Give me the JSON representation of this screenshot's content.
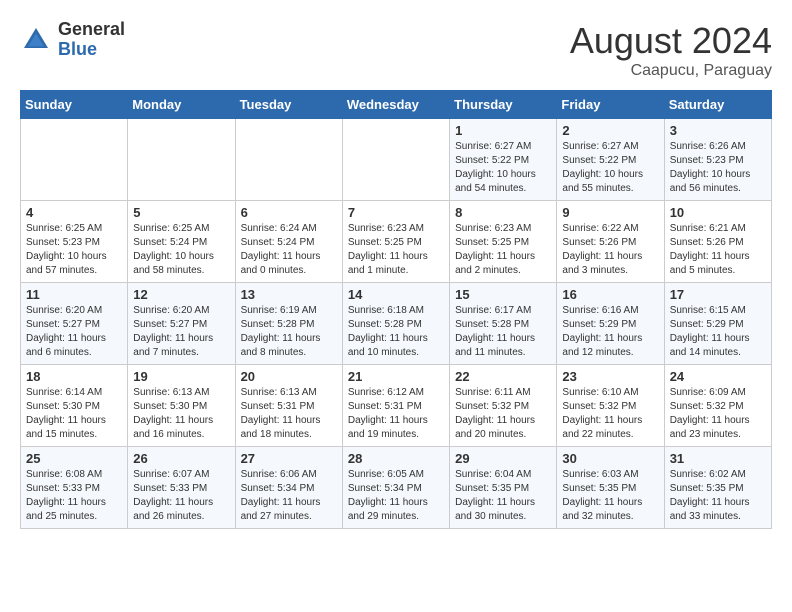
{
  "header": {
    "logo_general": "General",
    "logo_blue": "Blue",
    "month_year": "August 2024",
    "location": "Caapucu, Paraguay"
  },
  "days_of_week": [
    "Sunday",
    "Monday",
    "Tuesday",
    "Wednesday",
    "Thursday",
    "Friday",
    "Saturday"
  ],
  "weeks": [
    [
      {
        "day": "",
        "text": ""
      },
      {
        "day": "",
        "text": ""
      },
      {
        "day": "",
        "text": ""
      },
      {
        "day": "",
        "text": ""
      },
      {
        "day": "1",
        "text": "Sunrise: 6:27 AM\nSunset: 5:22 PM\nDaylight: 10 hours\nand 54 minutes."
      },
      {
        "day": "2",
        "text": "Sunrise: 6:27 AM\nSunset: 5:22 PM\nDaylight: 10 hours\nand 55 minutes."
      },
      {
        "day": "3",
        "text": "Sunrise: 6:26 AM\nSunset: 5:23 PM\nDaylight: 10 hours\nand 56 minutes."
      }
    ],
    [
      {
        "day": "4",
        "text": "Sunrise: 6:25 AM\nSunset: 5:23 PM\nDaylight: 10 hours\nand 57 minutes."
      },
      {
        "day": "5",
        "text": "Sunrise: 6:25 AM\nSunset: 5:24 PM\nDaylight: 10 hours\nand 58 minutes."
      },
      {
        "day": "6",
        "text": "Sunrise: 6:24 AM\nSunset: 5:24 PM\nDaylight: 11 hours\nand 0 minutes."
      },
      {
        "day": "7",
        "text": "Sunrise: 6:23 AM\nSunset: 5:25 PM\nDaylight: 11 hours\nand 1 minute."
      },
      {
        "day": "8",
        "text": "Sunrise: 6:23 AM\nSunset: 5:25 PM\nDaylight: 11 hours\nand 2 minutes."
      },
      {
        "day": "9",
        "text": "Sunrise: 6:22 AM\nSunset: 5:26 PM\nDaylight: 11 hours\nand 3 minutes."
      },
      {
        "day": "10",
        "text": "Sunrise: 6:21 AM\nSunset: 5:26 PM\nDaylight: 11 hours\nand 5 minutes."
      }
    ],
    [
      {
        "day": "11",
        "text": "Sunrise: 6:20 AM\nSunset: 5:27 PM\nDaylight: 11 hours\nand 6 minutes."
      },
      {
        "day": "12",
        "text": "Sunrise: 6:20 AM\nSunset: 5:27 PM\nDaylight: 11 hours\nand 7 minutes."
      },
      {
        "day": "13",
        "text": "Sunrise: 6:19 AM\nSunset: 5:28 PM\nDaylight: 11 hours\nand 8 minutes."
      },
      {
        "day": "14",
        "text": "Sunrise: 6:18 AM\nSunset: 5:28 PM\nDaylight: 11 hours\nand 10 minutes."
      },
      {
        "day": "15",
        "text": "Sunrise: 6:17 AM\nSunset: 5:28 PM\nDaylight: 11 hours\nand 11 minutes."
      },
      {
        "day": "16",
        "text": "Sunrise: 6:16 AM\nSunset: 5:29 PM\nDaylight: 11 hours\nand 12 minutes."
      },
      {
        "day": "17",
        "text": "Sunrise: 6:15 AM\nSunset: 5:29 PM\nDaylight: 11 hours\nand 14 minutes."
      }
    ],
    [
      {
        "day": "18",
        "text": "Sunrise: 6:14 AM\nSunset: 5:30 PM\nDaylight: 11 hours\nand 15 minutes."
      },
      {
        "day": "19",
        "text": "Sunrise: 6:13 AM\nSunset: 5:30 PM\nDaylight: 11 hours\nand 16 minutes."
      },
      {
        "day": "20",
        "text": "Sunrise: 6:13 AM\nSunset: 5:31 PM\nDaylight: 11 hours\nand 18 minutes."
      },
      {
        "day": "21",
        "text": "Sunrise: 6:12 AM\nSunset: 5:31 PM\nDaylight: 11 hours\nand 19 minutes."
      },
      {
        "day": "22",
        "text": "Sunrise: 6:11 AM\nSunset: 5:32 PM\nDaylight: 11 hours\nand 20 minutes."
      },
      {
        "day": "23",
        "text": "Sunrise: 6:10 AM\nSunset: 5:32 PM\nDaylight: 11 hours\nand 22 minutes."
      },
      {
        "day": "24",
        "text": "Sunrise: 6:09 AM\nSunset: 5:32 PM\nDaylight: 11 hours\nand 23 minutes."
      }
    ],
    [
      {
        "day": "25",
        "text": "Sunrise: 6:08 AM\nSunset: 5:33 PM\nDaylight: 11 hours\nand 25 minutes."
      },
      {
        "day": "26",
        "text": "Sunrise: 6:07 AM\nSunset: 5:33 PM\nDaylight: 11 hours\nand 26 minutes."
      },
      {
        "day": "27",
        "text": "Sunrise: 6:06 AM\nSunset: 5:34 PM\nDaylight: 11 hours\nand 27 minutes."
      },
      {
        "day": "28",
        "text": "Sunrise: 6:05 AM\nSunset: 5:34 PM\nDaylight: 11 hours\nand 29 minutes."
      },
      {
        "day": "29",
        "text": "Sunrise: 6:04 AM\nSunset: 5:35 PM\nDaylight: 11 hours\nand 30 minutes."
      },
      {
        "day": "30",
        "text": "Sunrise: 6:03 AM\nSunset: 5:35 PM\nDaylight: 11 hours\nand 32 minutes."
      },
      {
        "day": "31",
        "text": "Sunrise: 6:02 AM\nSunset: 5:35 PM\nDaylight: 11 hours\nand 33 minutes."
      }
    ]
  ]
}
